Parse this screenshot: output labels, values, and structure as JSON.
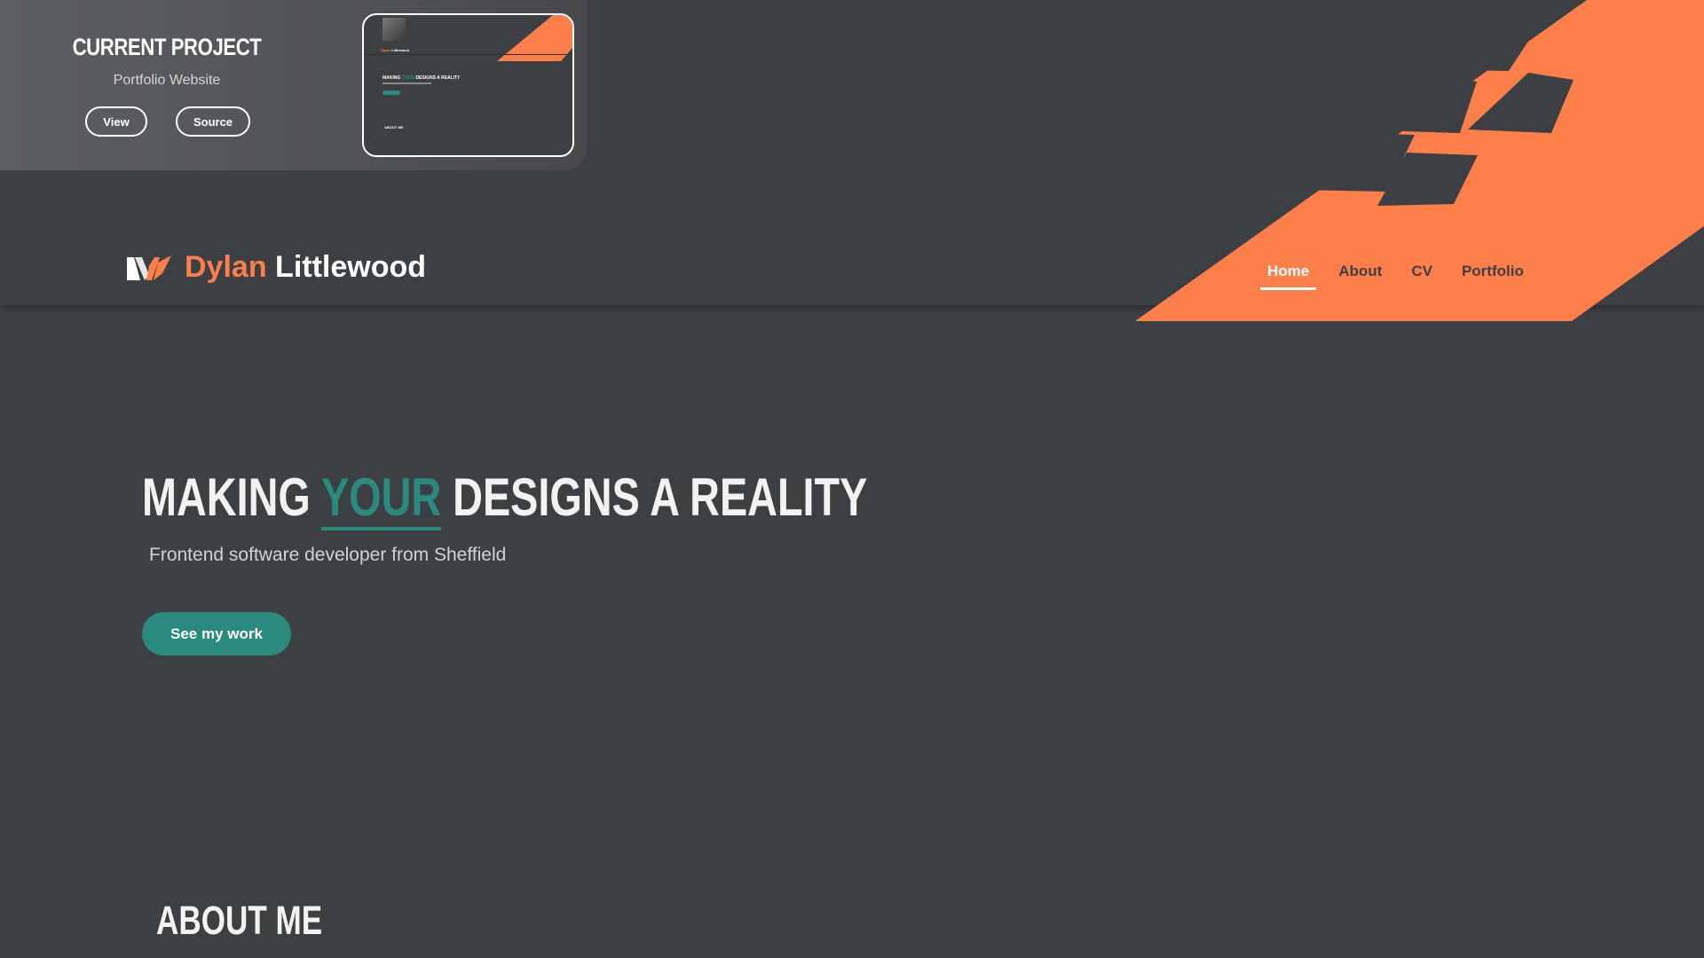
{
  "current_project": {
    "title": "CURRENT PROJECT",
    "name": "Portfolio Website",
    "view_label": "View",
    "source_label": "Source",
    "thumbnail": {
      "logo_first": "Dylan",
      "logo_last": "Littlewood",
      "heading_before": "MAKING",
      "heading_accent": "YOUR",
      "heading_after": "DESIGNS A REALITY",
      "about": "ABOUT ME"
    }
  },
  "header": {
    "brand_first": "Dylan",
    "brand_last": "Littlewood",
    "logo_icon": "dl-logo-icon"
  },
  "nav": {
    "items": [
      {
        "label": "Home",
        "active": true
      },
      {
        "label": "About",
        "active": false
      },
      {
        "label": "CV",
        "active": false
      },
      {
        "label": "Portfolio",
        "active": false
      }
    ]
  },
  "hero": {
    "title_before": "MAKING",
    "title_accent": "YOUR",
    "title_after": "DESIGNS A REALITY",
    "subtitle": "Frontend software developer from Sheffield",
    "cta_label": "See my work"
  },
  "about": {
    "heading": "ABOUT ME"
  },
  "colors": {
    "background": "#3d4043",
    "accent_orange": "#ff7f4a",
    "accent_teal": "#2a8a7e",
    "text_light": "#f2f2f2"
  }
}
